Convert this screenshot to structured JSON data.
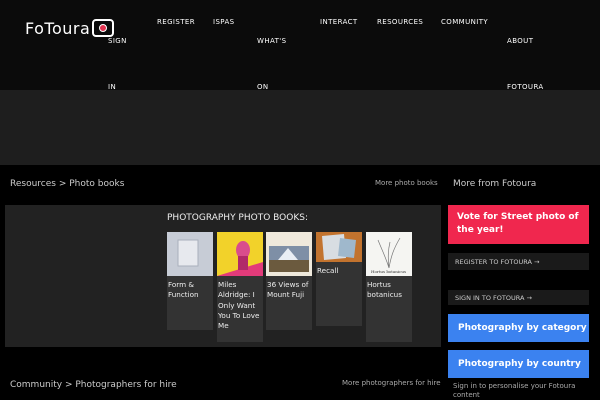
{
  "header": {
    "logo_text": "FoToura",
    "nav": [
      {
        "label": "SIGN IN"
      },
      {
        "label": "REGISTER"
      },
      {
        "label": "ISPAS"
      },
      {
        "label": "WHAT'S ON"
      },
      {
        "label": "INTERACT"
      },
      {
        "label": "RESOURCES"
      },
      {
        "label": "COMMUNITY"
      },
      {
        "label": "ABOUT FOTOURA"
      }
    ]
  },
  "breadcrumb1": {
    "text": "Resources > Photo books",
    "more": "More photo books"
  },
  "books": {
    "heading": "PHOTOGRAPHY PHOTO BOOKS:",
    "items": [
      {
        "title": "Form & Function"
      },
      {
        "title": "Miles Aldridge: I Only Want You To Love Me"
      },
      {
        "title": "36 Views of Mount Fuji"
      },
      {
        "title": "Recall"
      },
      {
        "title": "Hortus botanicus",
        "cover_text": "Hortus botanicus"
      }
    ]
  },
  "breadcrumb2": {
    "text": "Community > Photographers for hire",
    "more": "More photographers for hire"
  },
  "sidebar": {
    "title": "More from Fotoura",
    "vote": "Vote for Street photo of the year!",
    "register": "REGISTER TO FOTOURA →",
    "signin": "SIGN IN TO FOTOURA →",
    "by_category": "Photography by category",
    "by_country": "Photography by country",
    "note": "Sign in to personalise your Fotoura content"
  }
}
